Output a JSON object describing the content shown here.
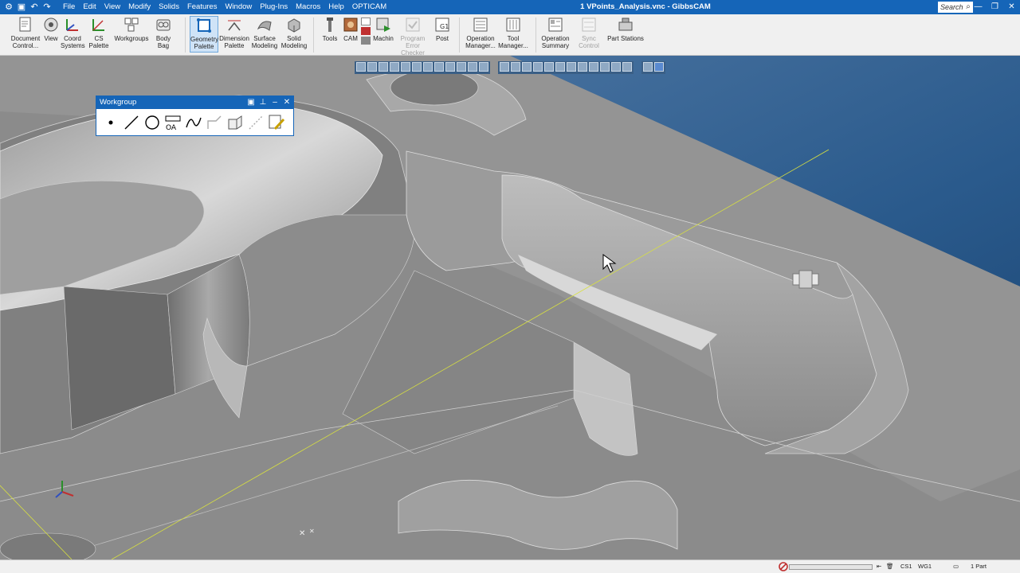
{
  "titlebar": {
    "menu": [
      "File",
      "Edit",
      "View",
      "Modify",
      "Solids",
      "Features",
      "Window",
      "Plug-Ins",
      "Macros",
      "Help",
      "OPTICAM"
    ],
    "doc_title": "1 VPoints_Analysis.vnc - GibbsCAM",
    "search_placeholder": "Search"
  },
  "ribbon": {
    "buttons": [
      {
        "label": "Document Control...",
        "icon": "document-icon"
      },
      {
        "label": "View",
        "icon": "view-icon"
      },
      {
        "label": "Coord Systems",
        "icon": "coord-systems-icon"
      },
      {
        "label": "CS Palette",
        "icon": "cs-palette-icon"
      },
      {
        "label": "Workgroups",
        "icon": "workgroups-icon"
      },
      {
        "label": "Body Bag",
        "icon": "body-bag-icon"
      },
      {
        "label": "Geometry Palette",
        "icon": "geometry-palette-icon",
        "active": true
      },
      {
        "label": "Dimension Palette",
        "icon": "dimension-palette-icon"
      },
      {
        "label": "Surface Modeling",
        "icon": "surface-modeling-icon"
      },
      {
        "label": "Solid Modeling",
        "icon": "solid-modeling-icon"
      },
      {
        "label": "Tools",
        "icon": "tools-icon"
      },
      {
        "label": "CAM",
        "icon": "cam-icon"
      },
      {
        "label": "Machin",
        "icon": "machine-icon"
      },
      {
        "label": "Program Error Checker",
        "icon": "error-checker-icon",
        "disabled": true
      },
      {
        "label": "Post",
        "icon": "post-icon"
      },
      {
        "label": "Operation Manager...",
        "icon": "operation-manager-icon"
      },
      {
        "label": "Tool Manager...",
        "icon": "tool-manager-icon"
      },
      {
        "label": "Operation Summary",
        "icon": "operation-summary-icon"
      },
      {
        "label": "Sync Control",
        "icon": "sync-control-icon",
        "disabled": true
      },
      {
        "label": "Part Stations",
        "icon": "part-stations-icon"
      }
    ]
  },
  "workgroup": {
    "title": "Workgroup",
    "tools": [
      "point-tool-icon",
      "line-tool-icon",
      "circle-tool-icon",
      "text-tool-icon",
      "spline-tool-icon",
      "shape-tool-icon",
      "solid-box-icon",
      "dashed-line-icon",
      "edit-pencil-icon"
    ]
  },
  "status": {
    "cs_label": "CS1",
    "wg_label": "WG1",
    "parts": "1 Part"
  },
  "colors": {
    "title_bar": "#1565b8",
    "ribbon_bg": "#f0f0f0",
    "viewport_bg": "#1f4f80",
    "part_gray": "#8e8e8e"
  }
}
